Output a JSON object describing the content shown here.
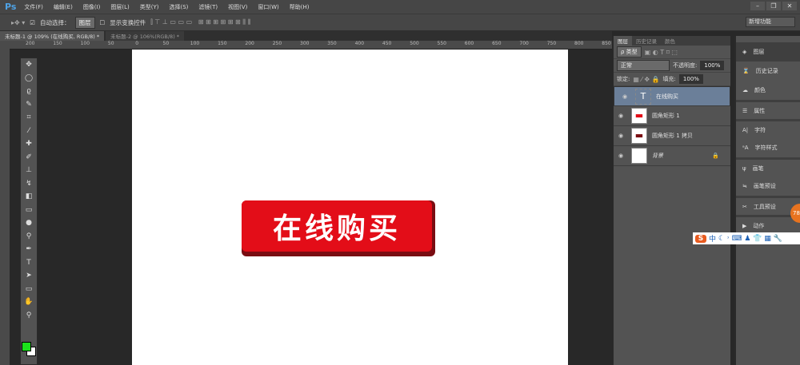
{
  "app": {
    "logo": "Ps"
  },
  "menu": [
    "文件(F)",
    "编辑(E)",
    "图像(I)",
    "图层(L)",
    "类型(Y)",
    "选择(S)",
    "滤镜(T)",
    "视图(V)",
    "窗口(W)",
    "帮助(H)"
  ],
  "window_controls": [
    "–",
    "❐",
    "✕"
  ],
  "options": {
    "auto_select_label": "自动选择：",
    "auto_select_value": "图层",
    "transform_label": "显示变换控件",
    "workspace": "新增功能"
  },
  "tabs": [
    "未标题-1 @ 109% (在线购买, RGB/8) *",
    "未标题-2 @ 106%(RGB/8) *"
  ],
  "ruler": [
    "200",
    "150",
    "100",
    "50",
    "0",
    "50",
    "100",
    "150",
    "200",
    "250",
    "300",
    "350",
    "400",
    "450",
    "500",
    "550",
    "600",
    "650",
    "700",
    "750",
    "800",
    "850"
  ],
  "canvas": {
    "button_text": "在线购买",
    "button_color": "#e30d18"
  },
  "layers_panel": {
    "tabs": [
      "图层",
      "历史记录",
      "颜色"
    ],
    "filter": "ρ 类型",
    "blend_mode": "正常",
    "opacity_label": "不透明度:",
    "opacity": "100%",
    "lock_label": "锁定:",
    "fill_label": "填充:",
    "fill": "100%",
    "layers": [
      {
        "name": "在线购买",
        "type": "text",
        "selected": true
      },
      {
        "name": "圆角矩形 1",
        "type": "shape"
      },
      {
        "name": "圆角矩形 1 拷贝",
        "type": "shape"
      },
      {
        "name": "背景",
        "type": "background",
        "locked": true
      }
    ]
  },
  "dock": [
    "图层",
    "历史记录",
    "颜色",
    "属性",
    "字符",
    "字符样式",
    "画笔",
    "画笔预设",
    "工具预设",
    "动作"
  ],
  "ime": {
    "logo": "S",
    "mode": "中"
  },
  "colors": {
    "foreground": "#1be21b",
    "background": "#ffffff"
  }
}
